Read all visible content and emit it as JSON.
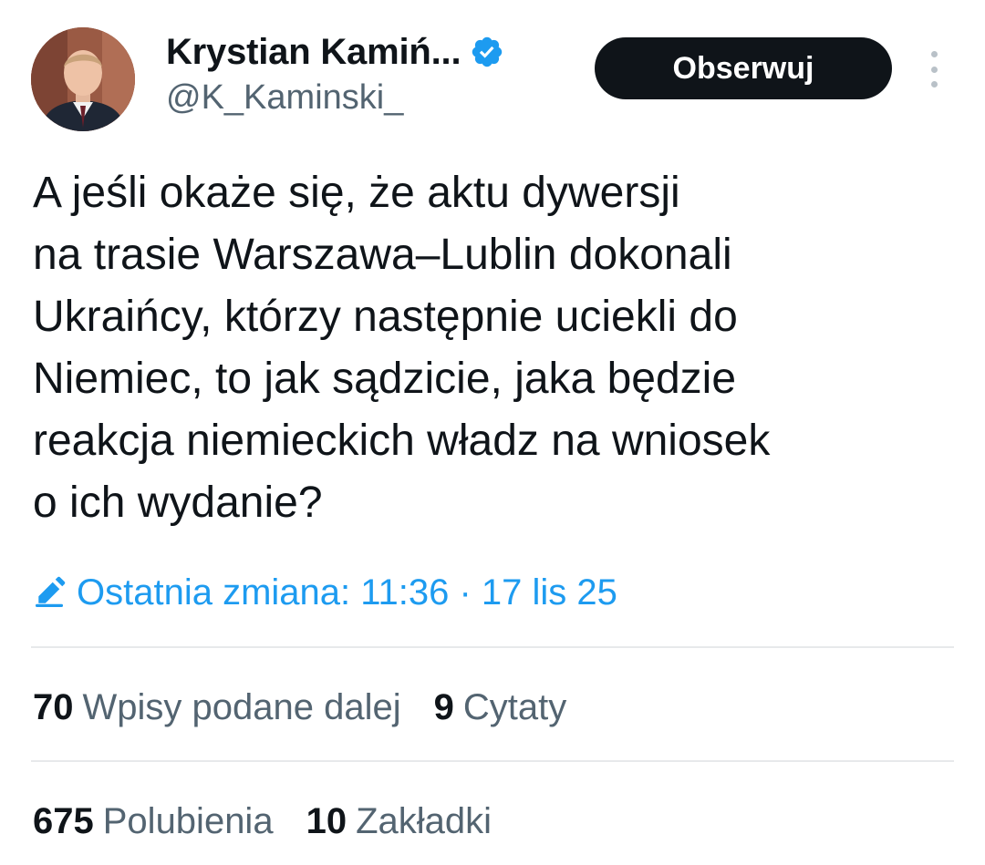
{
  "author": {
    "display_name": "Krystian Kamiń...",
    "handle": "@K_Kaminski_",
    "verified": true
  },
  "follow_button": {
    "label": "Obserwuj"
  },
  "tweet": {
    "lines": [
      "A jeśli okaże się, że aktu dywersji",
      "na trasie Warszawa–Lublin dokonali",
      "Ukraińcy, którzy następnie uciekli do",
      "Niemiec, to jak sądzicie, jaka będzie",
      "reakcja niemieckich władz na wniosek",
      "o ich wydanie?"
    ],
    "edited_label": "Ostatnia zmiana: 11:36 · 17 lis 25"
  },
  "stats": {
    "reposts": {
      "count": "70",
      "label": "Wpisy podane dalej"
    },
    "quotes": {
      "count": "9",
      "label": "Cytaty"
    },
    "likes": {
      "count": "675",
      "label": "Polubienia"
    },
    "bookmarks": {
      "count": "10",
      "label": "Zakładki"
    }
  },
  "colors": {
    "accent": "#1d9bf0",
    "text_primary": "#0f1419",
    "text_secondary": "#536471",
    "divider": "#e7e9eb",
    "button_bg": "#0f1419"
  },
  "icons": {
    "verified": "verified-badge-icon",
    "more": "more-vertical-icon",
    "edit": "pencil-edit-icon"
  }
}
